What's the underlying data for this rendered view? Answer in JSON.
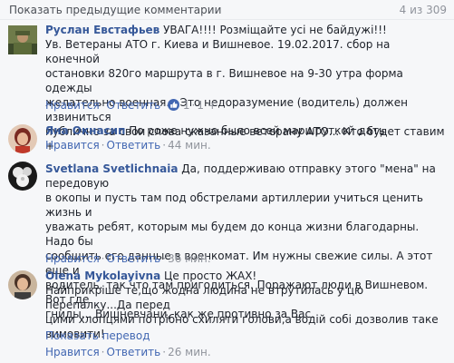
{
  "header": {
    "prev_comments": "Показать предыдущие комментарии",
    "counter": "4 из 309"
  },
  "comments": [
    {
      "author": "Руслан Евстафьев",
      "text_lines": [
        "УВАГА!!!! Розміщайте усі не байдужі!!!",
        "Ув. Ветераны АТО г. Киева и Вишневое. 19.02.2017. сбор на конечной",
        "остановки 820го маршрута в г. Вишневое на 9-30 утра форма одежды",
        "желательно военная... Это недоразумение (водитель) должен извиниться",
        "публично за свои слова сказанные ветерану АТО... Кто будет ставим +"
      ],
      "like": "Нравится",
      "reply": "Ответить",
      "reaction_count": "1",
      "time": "1 ч"
    },
    {
      "author": "Яна Окнасип",
      "text_lines": [
        "По роже нужно было всей маршруткой дать"
      ],
      "like": "Нравится",
      "reply": "Ответить",
      "time": "44 мин."
    },
    {
      "author": "Svetlana Svetlichnaia",
      "text_lines": [
        "Да, поддерживаю отправку этого \"мена\" на передовую",
        "в окопы и пусть там под обстрелами артиллерии учиться ценить жизнь и",
        "уважать ребят, которым мы будем до конца жизни благодарны. Надо бы",
        "сообщить его данные в военкомат. Им нужны свежие силы. А этот еще и",
        "водитель. так что там пригодиться. Поражают люди в Вишневом. Вот где",
        "гниды... Вишневчани, как же противно за Вас."
      ],
      "like": "Нравится",
      "reply": "Ответить",
      "time": "36 мин."
    },
    {
      "author": "Olena Mykolayivna",
      "text_lines": [
        "Це просто ЖАХ!",
        "Найприкріше те,що жодна людина не втрутилась у цю перепалку...Да перед",
        "цими хлопцями потрібно схиляти голови,а водій собі дозволив таке",
        "вимовити!"
      ],
      "translate": "Показать перевод",
      "like": "Нравится",
      "reply": "Ответить",
      "time": "26 мин."
    }
  ]
}
